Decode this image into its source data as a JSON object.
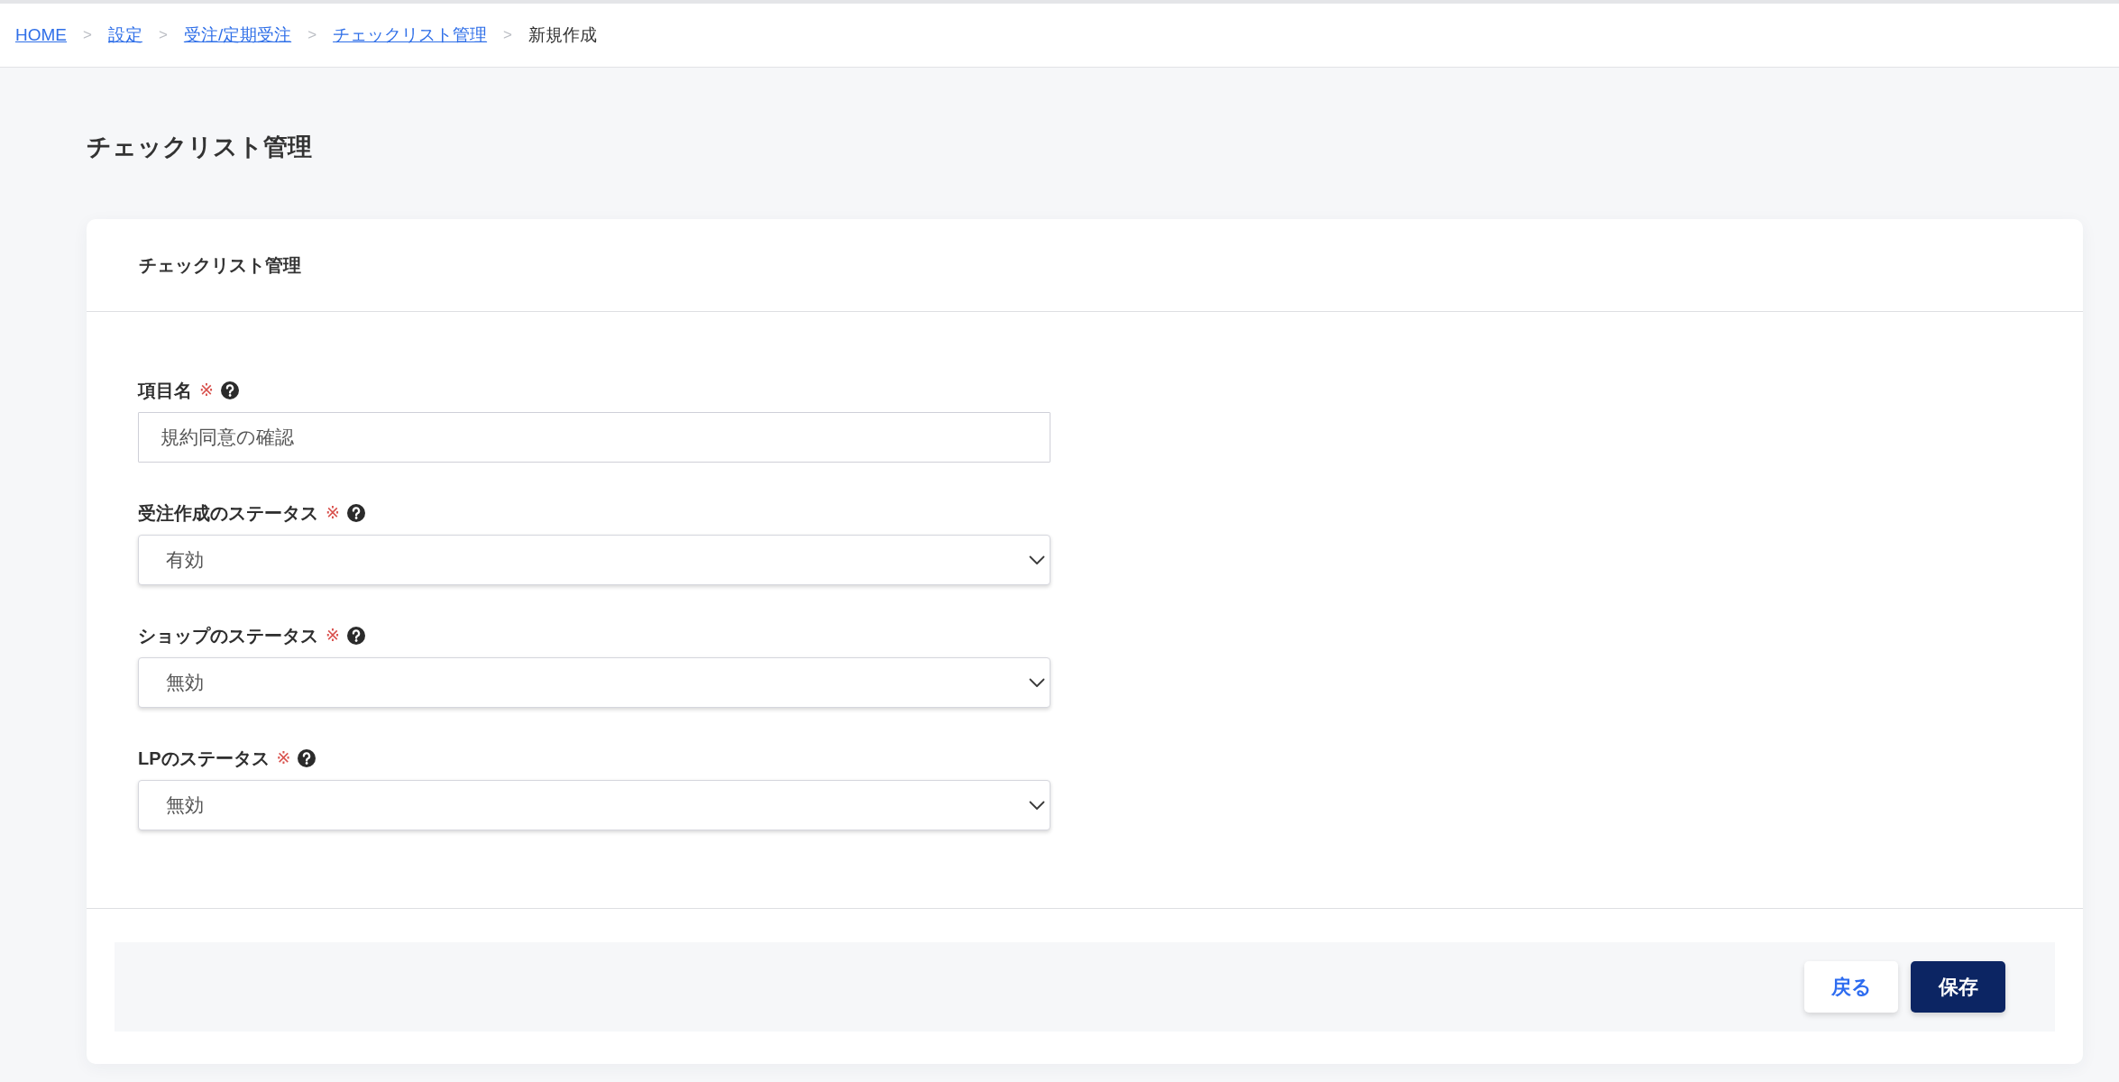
{
  "breadcrumb": [
    {
      "label": "HOME",
      "kind": "link"
    },
    {
      "label": "設定",
      "kind": "link",
      "separator": ">"
    },
    {
      "label": "受注/定期受注",
      "kind": "link",
      "separator": ">"
    },
    {
      "label": "チェックリスト管理",
      "kind": "link",
      "separator": ">"
    },
    {
      "label": "新規作成",
      "kind": "current",
      "separator": ">"
    }
  ],
  "page_title": "チェックリスト管理",
  "card": {
    "title": "チェックリスト管理",
    "fields": [
      {
        "kind": "text",
        "label": "項目名",
        "required_mark": "※",
        "help": true,
        "value": "規約同意の確認"
      },
      {
        "kind": "select",
        "label": "受注作成のステータス",
        "required_mark": "※",
        "help": true,
        "value": "有効"
      },
      {
        "kind": "select",
        "label": "ショップのステータス",
        "required_mark": "※",
        "help": true,
        "value": "無効"
      },
      {
        "kind": "select",
        "label": "LPのステータス",
        "required_mark": "※",
        "help": true,
        "value": "無効"
      }
    ],
    "buttons": [
      {
        "label": "戻る",
        "kind": "secondary"
      },
      {
        "label": "保存",
        "kind": "primary"
      }
    ]
  }
}
